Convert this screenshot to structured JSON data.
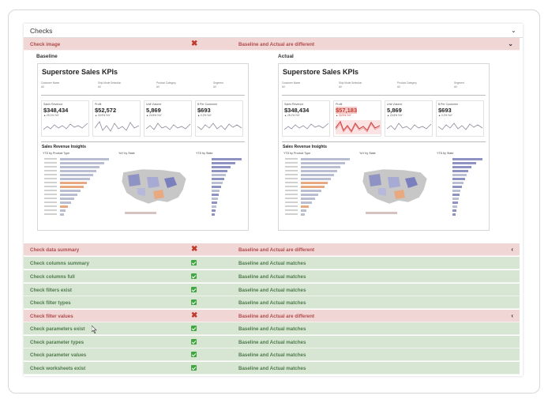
{
  "header": {
    "title": "Checks"
  },
  "image_check": {
    "name": "Check image",
    "status": "fail",
    "message": "Baseline and Actual are different",
    "baseline_label": "Baseline",
    "actual_label": "Actual",
    "dashboard": {
      "title": "Superstore Sales KPIs",
      "filters": [
        "Customer Name",
        "Ship Mode Selection",
        "Product Category",
        "Segment"
      ],
      "filter_values": [
        "All",
        "All",
        "All",
        "All"
      ],
      "insights_title": "Sales Revenue Insights",
      "subtitles": [
        "YTD by Product Type",
        "YoY by State",
        "YTD by State"
      ]
    },
    "baseline_kpis": [
      {
        "label": "Sales Revenue",
        "value": "$348,434",
        "delta": "▲ 25.1% YoY"
      },
      {
        "label": "Profit",
        "value": "$52,572",
        "delta": "▲ 33.9% YoY"
      },
      {
        "label": "Unit Volume",
        "value": "5,869",
        "delta": "▲ 24.5% YoY"
      },
      {
        "label": "$ Per Customer",
        "value": "$693",
        "delta": "▲ 0.2% YoY"
      }
    ],
    "actual_kpis": [
      {
        "label": "Sales Revenue",
        "value": "$348,434",
        "delta": "▲ 25.1% YoY"
      },
      {
        "label": "Profit",
        "value": "$57,183",
        "delta": "▲ 33.9% YoY"
      },
      {
        "label": "Unit Volume",
        "value": "5,869",
        "delta": "▲ 24.5% YoY"
      },
      {
        "label": "$ Per Customer",
        "value": "$693",
        "delta": "▲ 0.2% YoY"
      }
    ]
  },
  "checks": [
    {
      "name": "Check data summary",
      "status": "fail",
      "message": "Baseline and Actual are different"
    },
    {
      "name": "Check columns summary",
      "status": "pass",
      "message": "Baseline and Actual matches"
    },
    {
      "name": "Check columns full",
      "status": "pass",
      "message": "Baseline and Actual matches"
    },
    {
      "name": "Check filters exist",
      "status": "pass",
      "message": "Baseline and Actual matches"
    },
    {
      "name": "Check filter types",
      "status": "pass",
      "message": "Baseline and Actual matches"
    },
    {
      "name": "Check filter values",
      "status": "fail",
      "message": "Baseline and Actual are different"
    },
    {
      "name": "Check parameters exist",
      "status": "pass",
      "message": "Baseline and Actual matches"
    },
    {
      "name": "Check parameter types",
      "status": "pass",
      "message": "Baseline and Actual matches"
    },
    {
      "name": "Check parameter values",
      "status": "pass",
      "message": "Baseline and Actual matches"
    },
    {
      "name": "Check worksheets exist",
      "status": "pass",
      "message": "Baseline and Actual matches"
    }
  ],
  "colors": {
    "fail_bg": "#f1d6d6",
    "pass_bg": "#d7e6d3",
    "fail_text": "#b14a4a",
    "pass_text": "#4e7a4a"
  }
}
